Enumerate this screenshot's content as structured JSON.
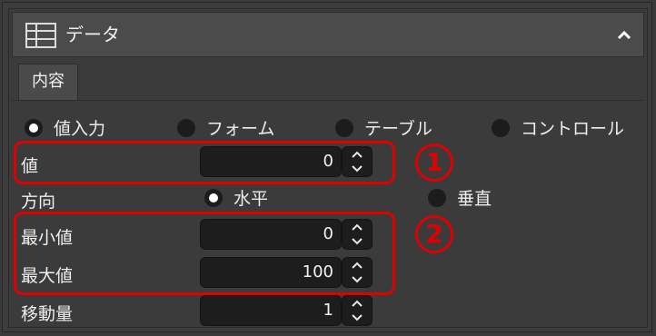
{
  "header": {
    "title": "データ",
    "icon": "table-icon",
    "collapse_icon": "chevron-up-icon"
  },
  "tabs": [
    {
      "label": "内容",
      "selected": true
    }
  ],
  "type_options": [
    {
      "label": "値入力",
      "selected": true
    },
    {
      "label": "フォーム",
      "selected": false
    },
    {
      "label": "テーブル",
      "selected": false
    },
    {
      "label": "コントロール",
      "selected": false
    }
  ],
  "value_field": {
    "label": "値",
    "value": "0"
  },
  "direction": {
    "label": "方向",
    "options": [
      {
        "label": "水平",
        "selected": true
      },
      {
        "label": "垂直",
        "selected": false
      }
    ]
  },
  "min_field": {
    "label": "最小値",
    "value": "0"
  },
  "max_field": {
    "label": "最大値",
    "value": "100"
  },
  "step_field": {
    "label": "移動量",
    "value": "1"
  },
  "annotations": {
    "badge1": "1",
    "badge2": "2",
    "color": "#e10000"
  }
}
